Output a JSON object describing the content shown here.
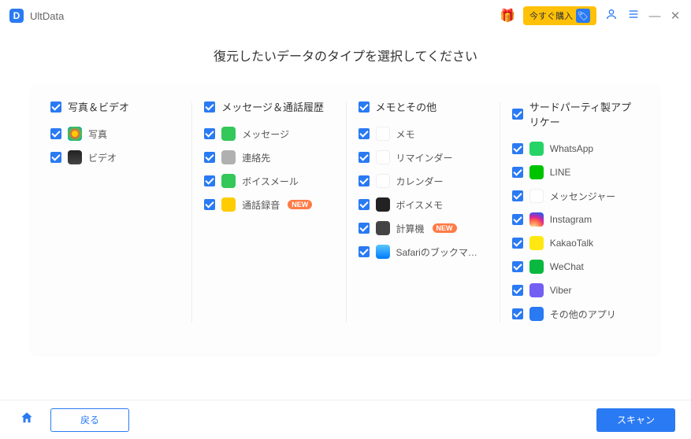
{
  "app": {
    "name": "UltData"
  },
  "titlebar": {
    "buy_now": "今すぐ購入"
  },
  "page": {
    "title": "復元したいデータのタイプを選択してください"
  },
  "groups": {
    "photos": {
      "title": "写真＆ビデオ",
      "items": [
        {
          "label": "写真",
          "icon": "photos-icon",
          "cls": "bg-photos"
        },
        {
          "label": "ビデオ",
          "icon": "videos-icon",
          "cls": "bg-videos"
        }
      ]
    },
    "messages": {
      "title": "メッセージ＆通話履歴",
      "items": [
        {
          "label": "メッセージ",
          "icon": "messages-icon",
          "cls": "bg-messages"
        },
        {
          "label": "連絡先",
          "icon": "contacts-icon",
          "cls": "bg-contacts"
        },
        {
          "label": "ボイスメール",
          "icon": "voicemail-icon",
          "cls": "bg-voicemail"
        },
        {
          "label": "通話録音",
          "icon": "call-record-icon",
          "cls": "bg-callrec",
          "badge": "NEW"
        }
      ]
    },
    "notes": {
      "title": "メモとその他",
      "items": [
        {
          "label": "メモ",
          "icon": "notes-icon",
          "cls": "bg-notes"
        },
        {
          "label": "リマインダー",
          "icon": "reminders-icon",
          "cls": "bg-reminders"
        },
        {
          "label": "カレンダー",
          "icon": "calendar-icon",
          "cls": "bg-calendar"
        },
        {
          "label": "ボイスメモ",
          "icon": "voice-memo-icon",
          "cls": "bg-voicememo"
        },
        {
          "label": "計算機",
          "icon": "calculator-icon",
          "cls": "bg-calc",
          "badge": "NEW"
        },
        {
          "label": "Safariのブックマ…",
          "icon": "safari-icon",
          "cls": "bg-safari"
        }
      ]
    },
    "thirdparty": {
      "title": "サードパーティ製アプリケー",
      "items": [
        {
          "label": "WhatsApp",
          "icon": "whatsapp-icon",
          "cls": "bg-whatsapp"
        },
        {
          "label": "LINE",
          "icon": "line-icon",
          "cls": "bg-line"
        },
        {
          "label": "メッセンジャー",
          "icon": "messenger-icon",
          "cls": "bg-messenger"
        },
        {
          "label": "Instagram",
          "icon": "instagram-icon",
          "cls": "bg-insta"
        },
        {
          "label": "KakaoTalk",
          "icon": "kakaotalk-icon",
          "cls": "bg-kakao"
        },
        {
          "label": "WeChat",
          "icon": "wechat-icon",
          "cls": "bg-wechat"
        },
        {
          "label": "Viber",
          "icon": "viber-icon",
          "cls": "bg-viber"
        },
        {
          "label": "その他のアプリ",
          "icon": "other-apps-icon",
          "cls": "bg-other"
        }
      ]
    }
  },
  "footer": {
    "back": "戻る",
    "scan": "スキャン"
  }
}
